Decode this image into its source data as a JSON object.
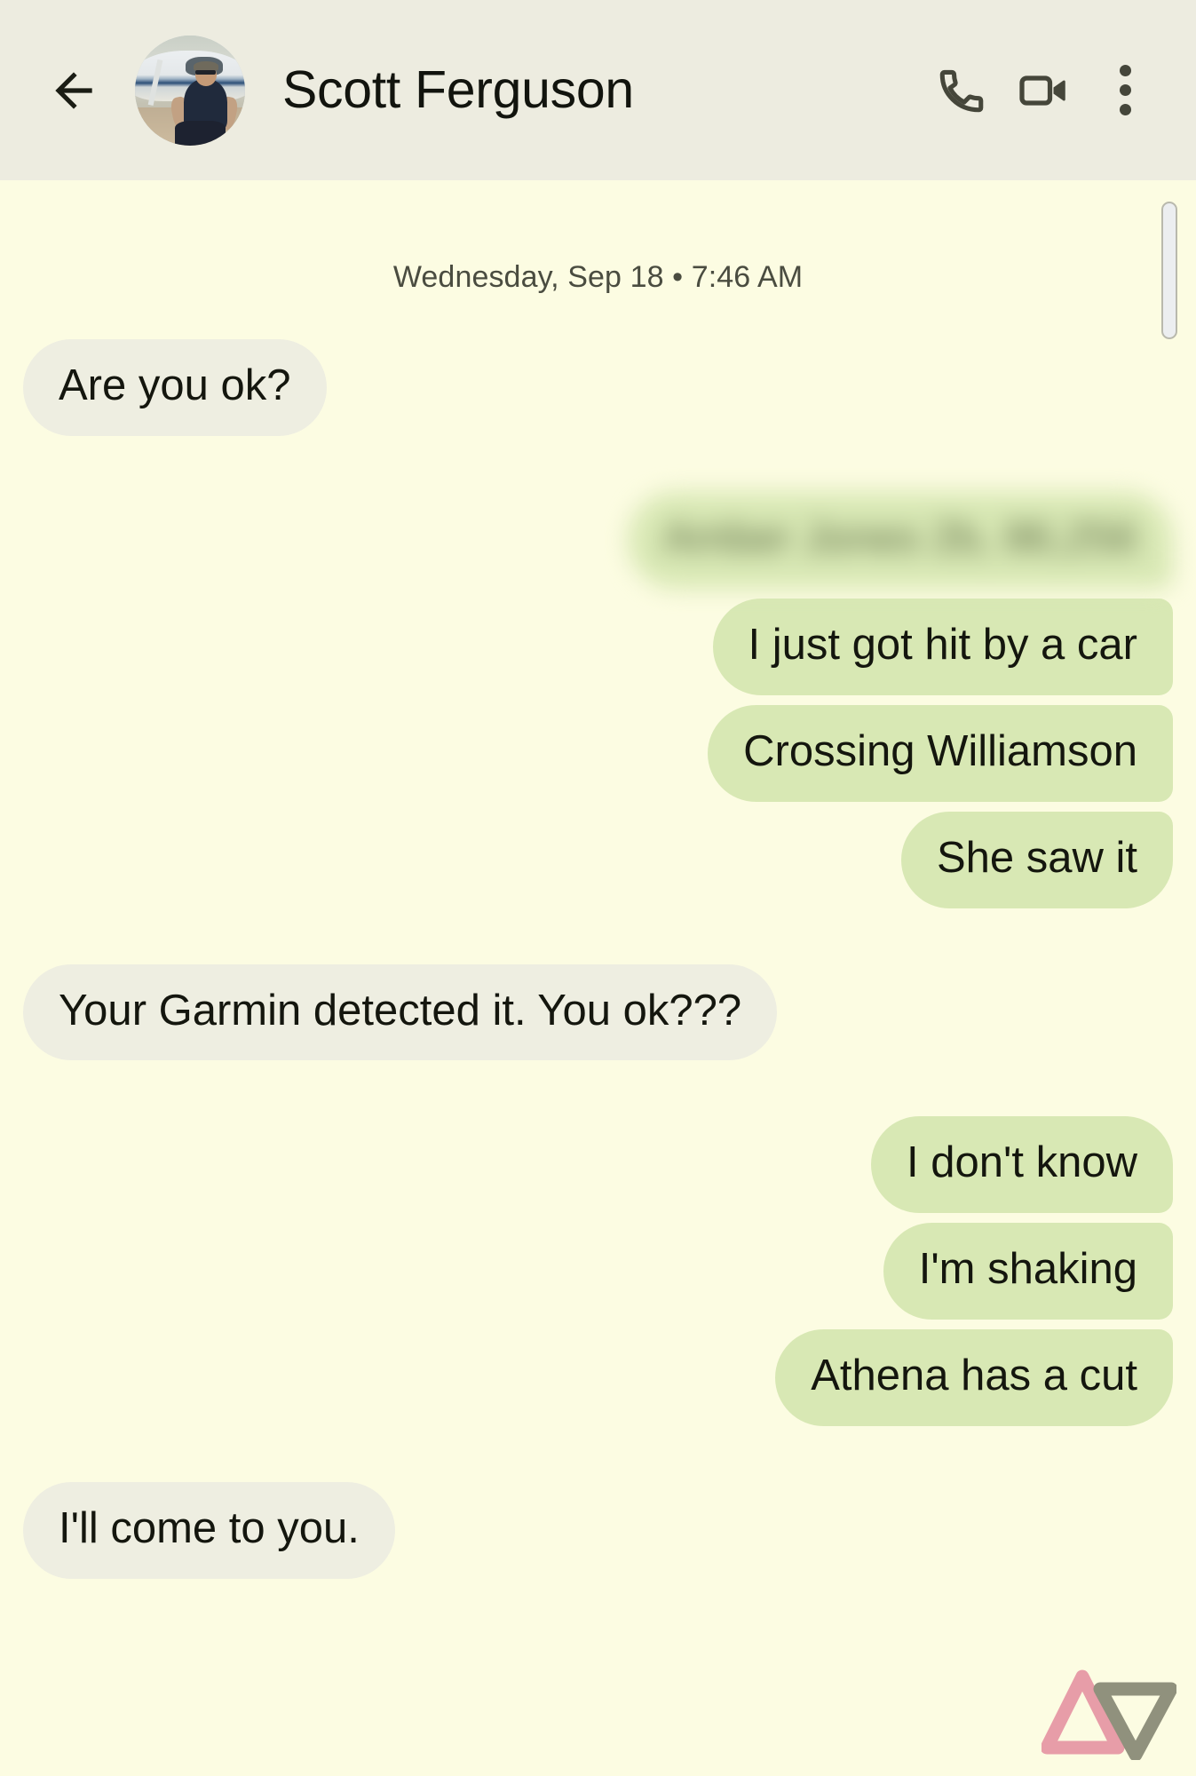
{
  "header": {
    "back_label": "Back",
    "contact_name": "Scott Ferguson",
    "avatar_alt": "Scott Ferguson profile photo",
    "actions": {
      "call": "Call",
      "video": "Video call",
      "more": "More options"
    }
  },
  "conversation": {
    "date_divider": "Wednesday, Sep 18 • 7:46 AM",
    "messages": [
      {
        "id": 1,
        "side": "in",
        "text": "Are you ok?"
      },
      {
        "id": 2,
        "side": "out",
        "text": "Amber Jones 2b, 86,256",
        "redacted": true
      },
      {
        "id": 3,
        "side": "out",
        "text": "I just got hit by a car"
      },
      {
        "id": 4,
        "side": "out",
        "text": "Crossing Williamson"
      },
      {
        "id": 5,
        "side": "out",
        "text": "She saw it"
      },
      {
        "id": 6,
        "side": "in",
        "text": "Your Garmin detected it. You ok???"
      },
      {
        "id": 7,
        "side": "out",
        "text": "I don't know"
      },
      {
        "id": 8,
        "side": "out",
        "text": "I'm shaking"
      },
      {
        "id": 9,
        "side": "out",
        "text": "Athena has a cut"
      },
      {
        "id": 10,
        "side": "in",
        "text": "I'll come to you."
      }
    ]
  },
  "scrollbar": {
    "position_label": "Scroll position near top"
  },
  "watermark": {
    "name": "Android Police logo",
    "colors": {
      "left_triangle": "#e79aa6",
      "right_triangle": "#8c8d79"
    }
  },
  "colors": {
    "header_bg": "#edece0",
    "chat_bg": "#fcfce2",
    "incoming_bubble": "#eeeee1",
    "outgoing_bubble": "#d8e8b4",
    "text": "#14160e",
    "icon": "#45463a"
  }
}
